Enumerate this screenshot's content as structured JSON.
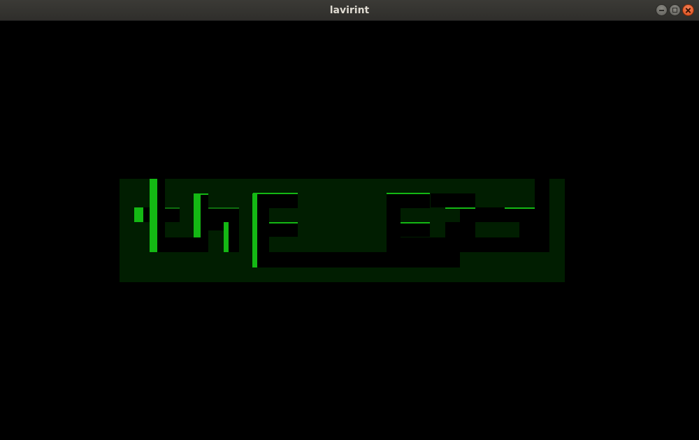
{
  "window": {
    "title": "lavirint",
    "controls": [
      "minimize-icon",
      "maximize-icon",
      "close-icon"
    ]
  },
  "colors": {
    "background": "#000000",
    "maze_floor": "#011e01",
    "wall_bright": "#14b814",
    "wall_dark": "#000000",
    "titlebar": "#3a3935",
    "close": "#e9541f"
  }
}
